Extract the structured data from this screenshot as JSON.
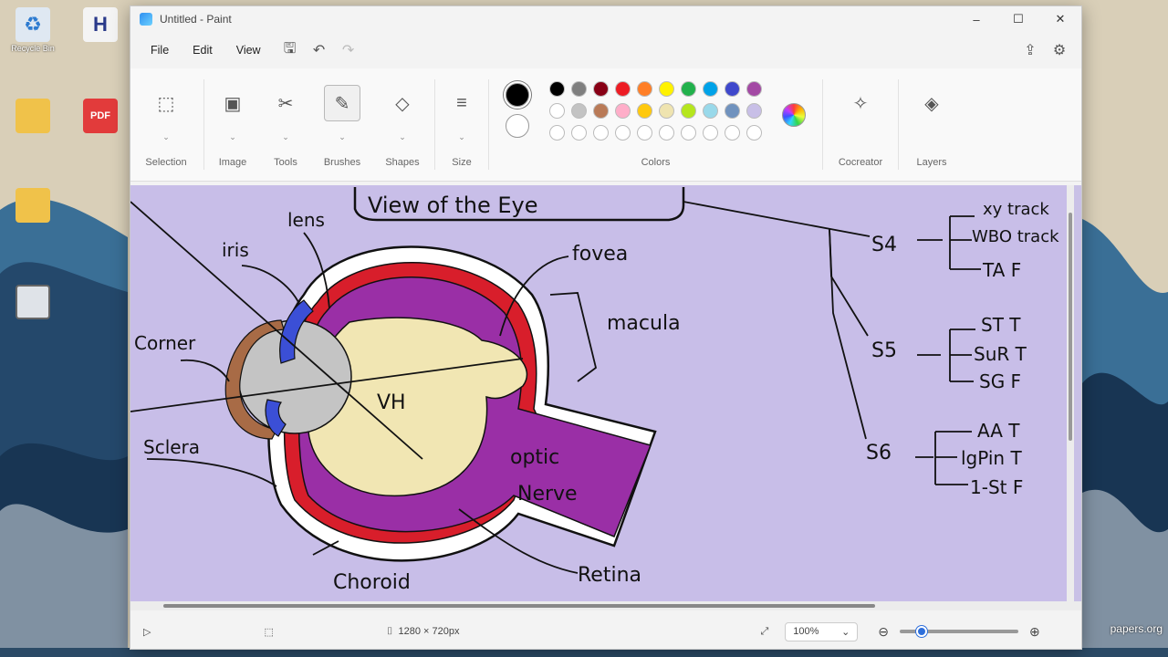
{
  "desktop": {
    "icons": [
      {
        "name": "recycle-bin",
        "label": "Recycle Bin",
        "color": "#dfe8f2"
      },
      {
        "name": "h-app",
        "label": "",
        "color": "#f4f4f4"
      },
      {
        "name": "folder-1",
        "label": "",
        "color": "#f0c24a"
      },
      {
        "name": "pdf-file",
        "label": "",
        "color": "#e23b3b"
      },
      {
        "name": "folder-2",
        "label": "",
        "color": "#f0c24a"
      },
      {
        "name": "screen-file",
        "label": "",
        "color": "#dfe3e8"
      }
    ],
    "watermark": "papers.org"
  },
  "window": {
    "title": "Untitled - Paint",
    "controls": [
      "–",
      "☐",
      "✕"
    ]
  },
  "menu": {
    "file": "File",
    "edit": "Edit",
    "view": "View"
  },
  "ribbon": {
    "groups": [
      {
        "id": "selection",
        "label": "Selection",
        "icon": "selection-icon",
        "glyph": "⬚"
      },
      {
        "id": "image",
        "label": "Image",
        "icon": "image-icon",
        "glyph": "▣"
      },
      {
        "id": "tools",
        "label": "Tools",
        "icon": "tools-icon",
        "glyph": "✂"
      },
      {
        "id": "brushes",
        "label": "Brushes",
        "icon": "brush-icon",
        "glyph": "✎"
      },
      {
        "id": "shapes",
        "label": "Shapes",
        "icon": "shapes-icon",
        "glyph": "◇"
      },
      {
        "id": "size",
        "label": "Size",
        "icon": "size-icon",
        "glyph": "≡"
      }
    ],
    "colors_label": "Colors",
    "cocreator_label": "Cocreator",
    "layers_label": "Layers",
    "primary_color": "#000000",
    "secondary_color": "#ffffff",
    "palette": [
      "#000000",
      "#7f7f7f",
      "#880015",
      "#ed1c24",
      "#ff7f27",
      "#fff200",
      "#22b14c",
      "#00a2e8",
      "#3f48cc",
      "#a349a4",
      "#ffffff",
      "#c3c3c3",
      "#b97a57",
      "#ffaec9",
      "#ffc90e",
      "#efe4b0",
      "#b5e61d",
      "#99d9ea",
      "#7092be",
      "#c8bfe7",
      "#ffffff",
      "#ffffff",
      "#ffffff",
      "#ffffff",
      "#ffffff",
      "#ffffff",
      "#ffffff",
      "#ffffff",
      "#ffffff",
      "#ffffff"
    ]
  },
  "drawing": {
    "title": "View of the Eye",
    "labels": {
      "iris": "iris",
      "lens": "lens",
      "cornea": "Corner",
      "sclera": "Sclera",
      "fovea": "fovea",
      "macula": "macula",
      "vh": "VH",
      "optic_nerve_1": "optic",
      "optic_nerve_2": "Nerve",
      "choroid": "Choroid",
      "retina": "Retina"
    },
    "tree": [
      {
        "node": "S4",
        "children": [
          "xy track",
          "WBO track",
          "TA F"
        ]
      },
      {
        "node": "S5",
        "children": [
          "ST T",
          "SuR T",
          "SG F"
        ]
      },
      {
        "node": "S6",
        "children": [
          "AA T",
          "lgPin T",
          "1-St F"
        ]
      }
    ]
  },
  "status": {
    "dimensions": "1280 × 720px",
    "zoom": "100%"
  }
}
